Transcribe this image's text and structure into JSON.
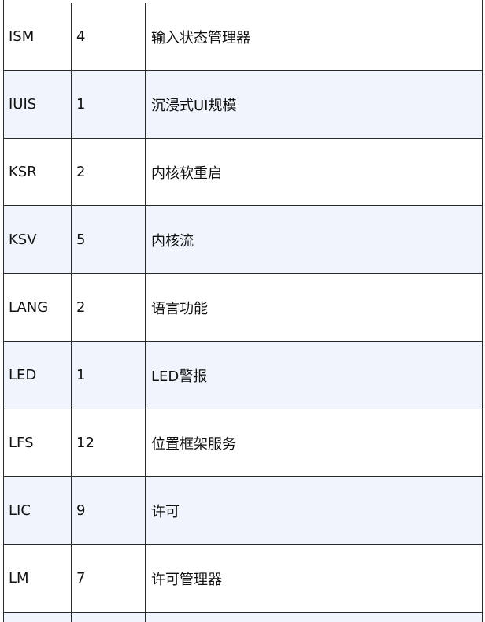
{
  "table": {
    "rows": [
      {
        "code": "ISM",
        "count": "4",
        "name": "输入状态管理器"
      },
      {
        "code": "IUIS",
        "count": "1",
        "name": "沉浸式UI规模"
      },
      {
        "code": "KSR",
        "count": "2",
        "name": "内核软重启"
      },
      {
        "code": "KSV",
        "count": "5",
        "name": "内核流"
      },
      {
        "code": "LANG",
        "count": "2",
        "name": "语言功能"
      },
      {
        "code": "LED",
        "count": "1",
        "name": "LED警报"
      },
      {
        "code": "LFS",
        "count": "12",
        "name": "位置框架服务"
      },
      {
        "code": "LIC",
        "count": "9",
        "name": "许可"
      },
      {
        "code": "LM",
        "count": "7",
        "name": "许可管理器"
      }
    ],
    "colors": {
      "row_alt_background": "#f0f5fd",
      "row_background": "#ffffff",
      "border": "#2b2b2b"
    }
  }
}
